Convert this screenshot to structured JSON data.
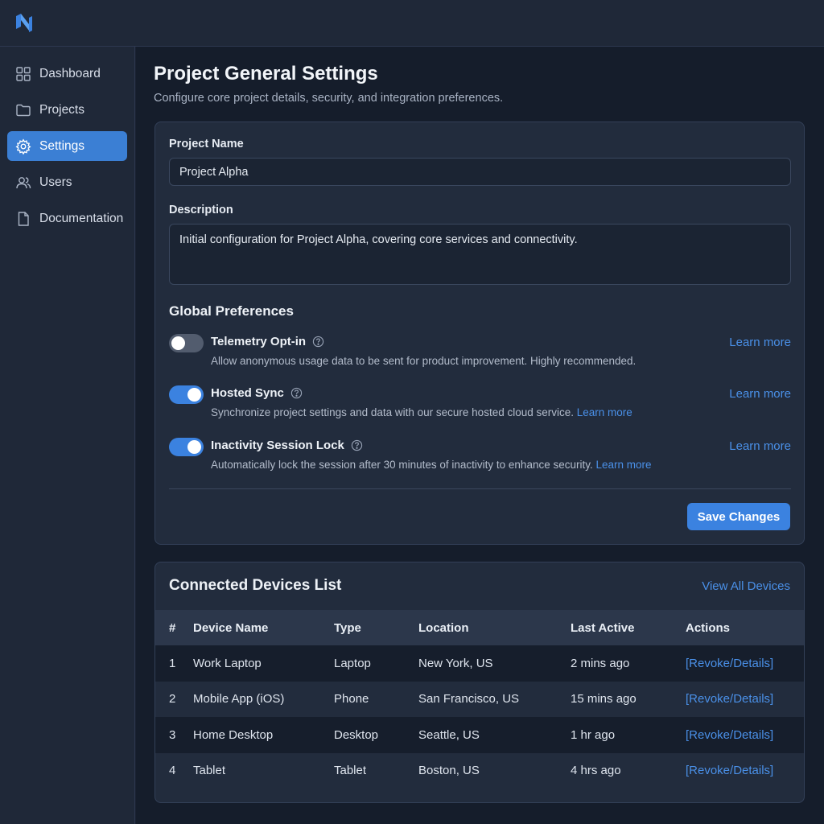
{
  "app": {
    "logo": "brand-logo"
  },
  "sidebar": {
    "items": [
      {
        "label": "Dashboard",
        "icon": "grid-icon",
        "active": false
      },
      {
        "label": "Projects",
        "icon": "folder-icon",
        "active": false
      },
      {
        "label": "Settings",
        "icon": "gear-icon",
        "active": true
      },
      {
        "label": "Users",
        "icon": "users-icon",
        "active": false
      },
      {
        "label": "Documentation",
        "icon": "document-icon",
        "active": false
      }
    ]
  },
  "page": {
    "title": "Project General Settings",
    "subtitle": "Configure core project details, security, and integration preferences."
  },
  "form": {
    "name_label": "Project Name",
    "name_value": "Project Alpha",
    "description_label": "Description",
    "description_value": "Initial configuration for Project Alpha, covering core services and connectivity.",
    "preferences_title": "Global Preferences",
    "preferences": [
      {
        "title": "Telemetry Opt-in",
        "enabled": false,
        "description": "Allow anonymous usage data to be sent for product improvement. Highly recommended.",
        "inline_link": "",
        "link": "Learn more"
      },
      {
        "title": "Hosted Sync",
        "enabled": true,
        "description": "Synchronize project settings and data with our secure hosted cloud service.",
        "inline_link": "Learn more",
        "link": "Learn more"
      },
      {
        "title": "Inactivity Session Lock",
        "enabled": true,
        "description": "Automatically lock the session after 30 minutes of inactivity to enhance security.",
        "inline_link": "Learn more",
        "link": "Learn more"
      }
    ],
    "save_label": "Save Changes"
  },
  "devices": {
    "title": "Connected Devices List",
    "view_all": "View All Devices",
    "columns": [
      "#",
      "Device Name",
      "Type",
      "Location",
      "Last Active",
      "Actions"
    ],
    "rows": [
      {
        "num": "1",
        "name": "Work Laptop",
        "type": "Laptop",
        "location": "New York, US",
        "last_active": "2 mins ago",
        "action": "[Revoke/Details]"
      },
      {
        "num": "2",
        "name": "Mobile App (iOS)",
        "type": "Phone",
        "location": "San Francisco, US",
        "last_active": "15 mins ago",
        "action": "[Revoke/Details]"
      },
      {
        "num": "3",
        "name": "Home Desktop",
        "type": "Desktop",
        "location": "Seattle, US",
        "last_active": "1 hr ago",
        "action": "[Revoke/Details]"
      },
      {
        "num": "4",
        "name": "Tablet",
        "type": "Tablet",
        "location": "Boston, US",
        "last_active": "4 hrs ago",
        "action": "[Revoke/Details]"
      }
    ]
  },
  "colors": {
    "accent": "#3b82e0",
    "link": "#4a90e8",
    "background": "#151d2b",
    "panel": "#222c3d"
  }
}
